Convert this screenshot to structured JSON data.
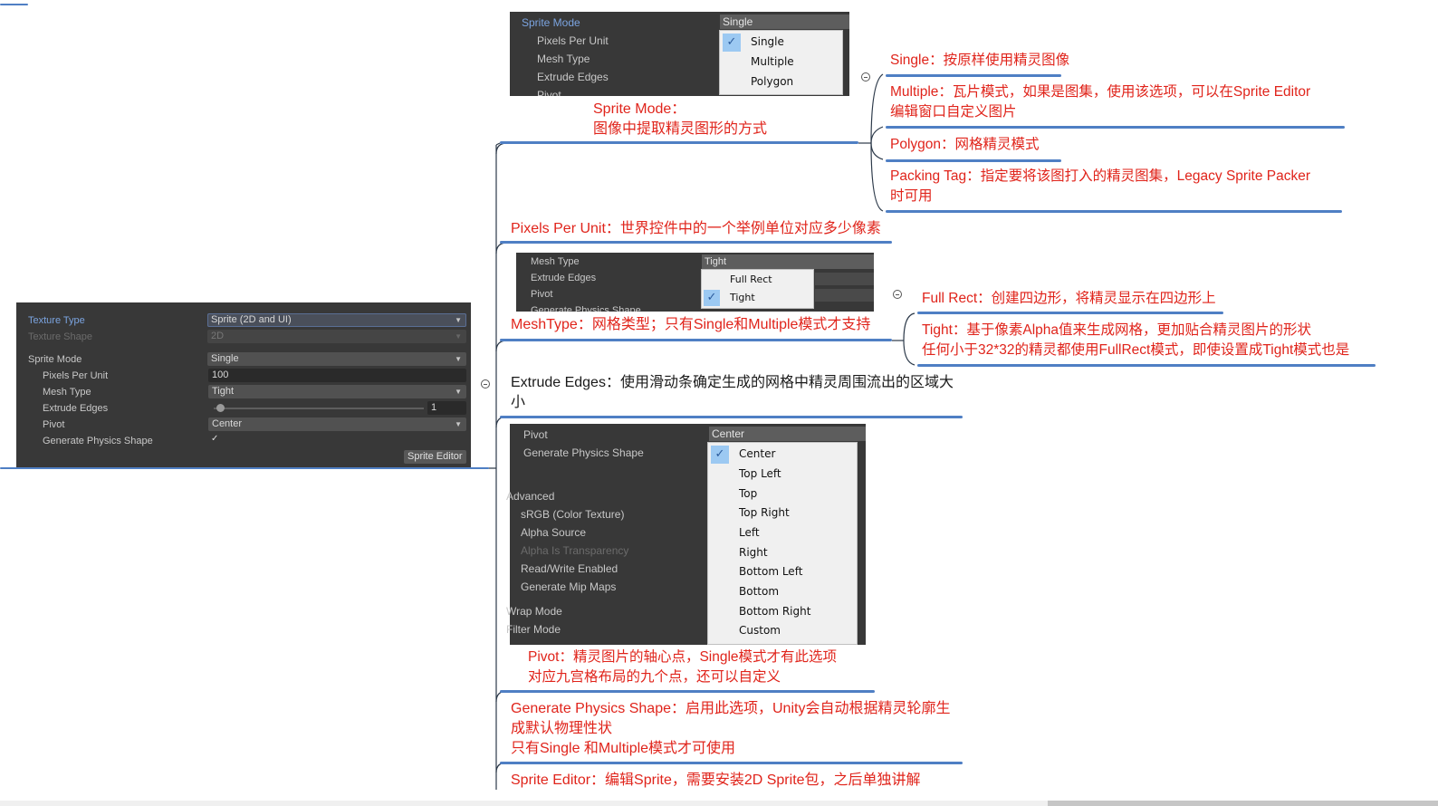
{
  "left_panel": {
    "rows": [
      {
        "label": "Texture Type",
        "value": "Sprite (2D and UI)"
      },
      {
        "label": "Texture Shape",
        "value": "2D"
      },
      {
        "label": "Sprite Mode",
        "value": "Single"
      },
      {
        "label": "Pixels Per Unit",
        "value": "100"
      },
      {
        "label": "Mesh Type",
        "value": "Tight"
      },
      {
        "label": "Extrude Edges",
        "value": "1"
      },
      {
        "label": "Pivot",
        "value": "Center"
      },
      {
        "label": "Generate Physics Shape",
        "value": "✓"
      }
    ],
    "button": "Sprite Editor"
  },
  "sprite_mode_shot": {
    "labels": [
      "Sprite Mode",
      "Pixels Per Unit",
      "Mesh Type",
      "Extrude Edges",
      "Pivot"
    ],
    "header_value": "Single",
    "options": [
      "Single",
      "Multiple",
      "Polygon"
    ],
    "selected": "Single"
  },
  "mesh_type_shot": {
    "labels": [
      "Mesh Type",
      "Extrude Edges",
      "Pivot",
      "Generate Physics Shape"
    ],
    "header_value": "Tight",
    "options": [
      "Full Rect",
      "Tight"
    ],
    "selected": "Tight"
  },
  "pivot_shot": {
    "labels": [
      "Pivot",
      "Generate Physics Shape",
      "Advanced",
      "sRGB (Color Texture)",
      "Alpha Source",
      "Alpha Is Transparency",
      "Read/Write Enabled",
      "Generate Mip Maps",
      "Wrap Mode",
      "Filter Mode"
    ],
    "header_value": "Center",
    "options": [
      "Center",
      "Top Left",
      "Top",
      "Top Right",
      "Left",
      "Right",
      "Bottom Left",
      "Bottom",
      "Bottom Right",
      "Custom"
    ],
    "selected": "Center"
  },
  "nodes": {
    "sprite_mode": {
      "line1": "Sprite Mode：",
      "line2": "图像中提取精灵图形的方式"
    },
    "single": "Single：按原样使用精灵图像",
    "multiple": {
      "line1": "Multiple：瓦片模式，如果是图集，使用该选项，可以在Sprite Editor",
      "line2": "编辑窗口自定义图片"
    },
    "polygon": "Polygon：网格精灵模式",
    "packing_tag": {
      "line1": "Packing Tag：指定要将该图打入的精灵图集，Legacy Sprite Packer",
      "line2": "时可用"
    },
    "pixels_per_unit": "Pixels Per Unit：世界控件中的一个举例单位对应多少像素",
    "mesh_type": "MeshType：网格类型；只有Single和Multiple模式才支持",
    "full_rect": "Full Rect：创建四边形，将精灵显示在四边形上",
    "tight": {
      "line1": "Tight：基于像素Alpha值来生成网格，更加贴合精灵图片的形状",
      "line2": "任何小于32*32的精灵都使用FullRect模式，即使设置成Tight模式也是"
    },
    "extrude_edges": {
      "line1": "Extrude Edges：使用滑动条确定生成的网格中精灵周围流出的区域大",
      "line2": "小"
    },
    "pivot": {
      "line1": "Pivot：精灵图片的轴心点，Single模式才有此选项",
      "line2": "对应九宫格布局的九个点，还可以自定义"
    },
    "generate_physics": {
      "line1": "Generate Physics Shape：启用此选项，Unity会自动根据精灵轮廓生",
      "line2": "成默认物理性状",
      "line3": "只有Single 和Multiple模式才可使用"
    },
    "sprite_editor": "Sprite Editor：编辑Sprite，需要安装2D Sprite包，之后单独讲解"
  },
  "colors": {
    "accent_line": "#4f7fc4",
    "text_red": "#e0241b",
    "panel_bg": "#383838"
  }
}
